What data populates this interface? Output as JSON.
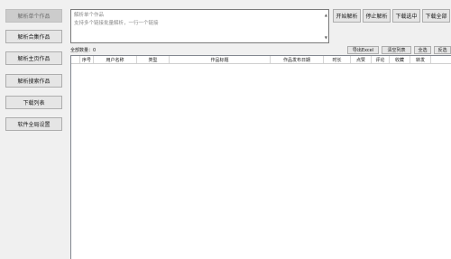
{
  "sidebar": {
    "items": [
      {
        "label": "解析单个作品"
      },
      {
        "label": "解析合集作品"
      },
      {
        "label": "解析主页作品"
      },
      {
        "label": "解析搜索作品"
      },
      {
        "label": "下载列表"
      },
      {
        "label": "软件全局设置"
      }
    ]
  },
  "input": {
    "placeholder_line1": "解析单个作品",
    "placeholder_line2": "支持多个链接批量解析，一行一个链接"
  },
  "toolbar": {
    "start_label": "开始解析",
    "stop_label": "停止解析",
    "download_selected_label": "下载选中",
    "download_all_label": "下载全部"
  },
  "list": {
    "count_text": "全部数量：0",
    "export_label": "导出Excel",
    "clear_label": "清空列表",
    "select_all_label": "全选",
    "invert_label": "反选"
  },
  "table": {
    "headers": [
      "序号",
      "用户名称",
      "类型",
      "作品标题",
      "作品发布日期",
      "时长",
      "点赞",
      "评论",
      "收藏",
      "转发"
    ]
  }
}
